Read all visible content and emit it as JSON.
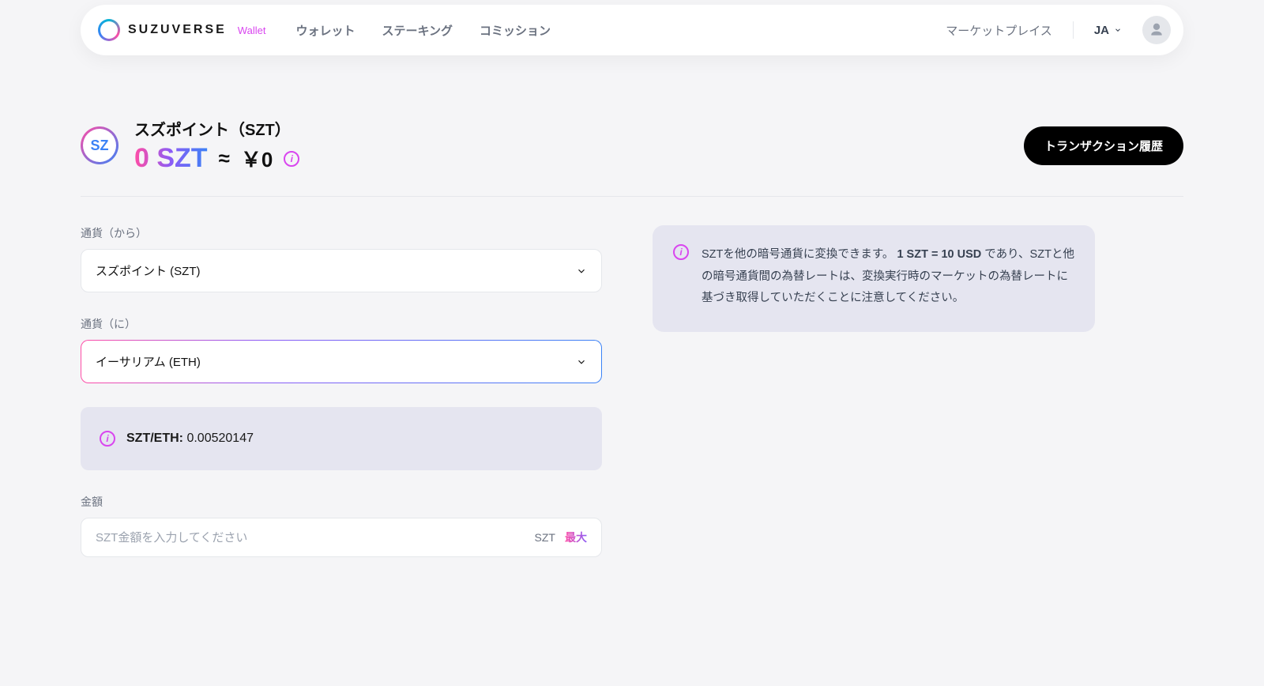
{
  "brand": {
    "name": "SUZUVERSE",
    "sub": "Wallet"
  },
  "nav": {
    "links": [
      "ウォレット",
      "ステーキング",
      "コミッション"
    ],
    "marketplace": "マーケットプレイス",
    "lang": "JA"
  },
  "balance": {
    "title": "スズポイント（SZT）",
    "amount": "0 SZT",
    "approx_symbol": "≈",
    "approx_value": "￥0",
    "coin_glyph": "SZ",
    "tx_button": "トランザクション履歴"
  },
  "form": {
    "from_label": "通貨（から）",
    "from_value": "スズポイント (SZT)",
    "to_label": "通貨（に）",
    "to_value": "イーサリアム (ETH)",
    "rate_label": "SZT/ETH:",
    "rate_value": "0.00520147",
    "amount_label": "金額",
    "amount_placeholder": "SZT金額を入力してください",
    "unit": "SZT",
    "max": "最大"
  },
  "notice": {
    "prefix": "SZTを他の暗号通貨に変換できます。",
    "bold": "1 SZT = 10 USD",
    "suffix": " であり、SZTと他の暗号通貨間の為替レートは、変換実行時のマーケットの為替レートに基づき取得していただくことに注意してください。"
  }
}
